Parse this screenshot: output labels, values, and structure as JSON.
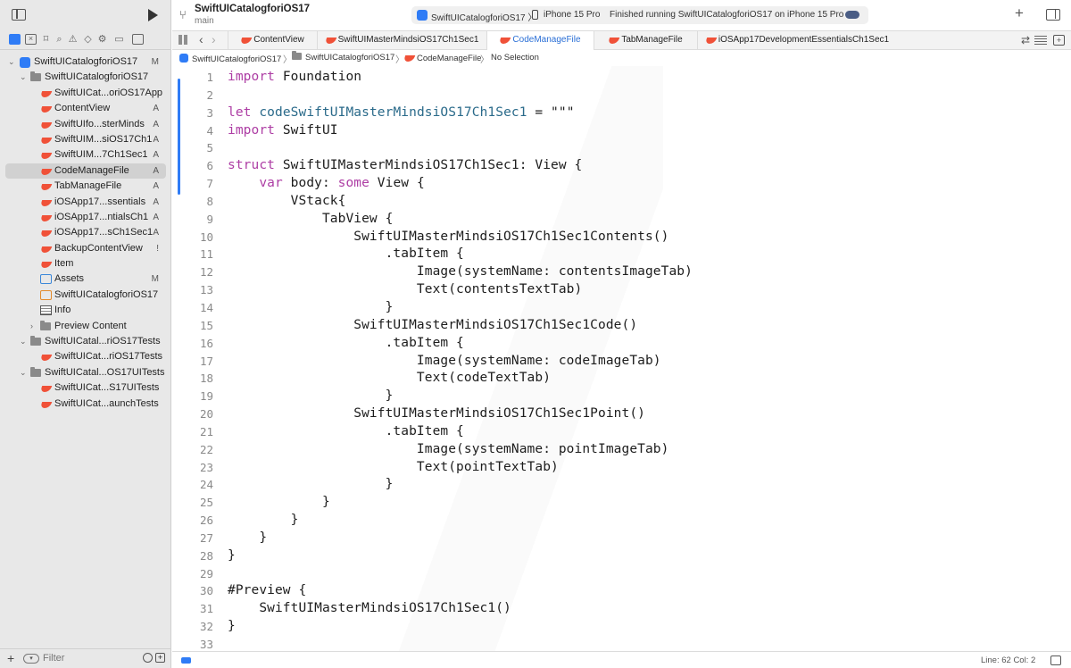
{
  "toolbar": {
    "project_name": "SwiftUICatalogforiOS17",
    "branch": "main",
    "scheme_target": "SwiftUICatalogforiOS17",
    "device": "iPhone 15 Pro",
    "status": "Finished running SwiftUICatalogforiOS17 on iPhone 15 Pro",
    "plus_label": "+",
    "chevron": "〉"
  },
  "tabs": [
    {
      "label": "ContentView",
      "active": false
    },
    {
      "label": "SwiftUIMasterMindsiOS17Ch1Sec1",
      "active": false
    },
    {
      "label": "CodeManageFile",
      "active": true
    },
    {
      "label": "TabManageFile",
      "active": false
    },
    {
      "label": "iOSApp17DevelopmentEssentialsCh1Sec1",
      "active": false
    }
  ],
  "tab_nav": {
    "back": "‹",
    "forward": "›"
  },
  "jumpbar": {
    "items": [
      "SwiftUICatalogforiOS17",
      "SwiftUICatalogforiOS17",
      "CodeManageFile",
      "No Selection"
    ],
    "separator": "〉"
  },
  "navigator": {
    "tree": [
      {
        "label": "SwiftUICatalogforiOS17",
        "badge": "M"
      },
      {
        "label": "SwiftUICatalogforiOS17",
        "badge": ""
      },
      {
        "label": "SwiftUICat...oriOS17App",
        "badge": ""
      },
      {
        "label": "ContentView",
        "badge": "A"
      },
      {
        "label": "SwiftUIfo...sterMinds",
        "badge": "A"
      },
      {
        "label": "SwiftUIM...siOS17Ch1",
        "badge": "A"
      },
      {
        "label": "SwiftUIM...7Ch1Sec1",
        "badge": "A"
      },
      {
        "label": "CodeManageFile",
        "badge": "A"
      },
      {
        "label": "TabManageFile",
        "badge": "A"
      },
      {
        "label": "iOSApp17...ssentials",
        "badge": "A"
      },
      {
        "label": "iOSApp17...ntialsCh1",
        "badge": "A"
      },
      {
        "label": "iOSApp17...sCh1Sec1",
        "badge": "A"
      },
      {
        "label": "BackupContentView",
        "badge": "!"
      },
      {
        "label": "Item",
        "badge": ""
      },
      {
        "label": "Assets",
        "badge": "M"
      },
      {
        "label": "SwiftUICatalogforiOS17",
        "badge": ""
      },
      {
        "label": "Info",
        "badge": ""
      },
      {
        "label": "Preview Content",
        "badge": ""
      },
      {
        "label": "SwiftUICatal...riOS17Tests",
        "badge": ""
      },
      {
        "label": "SwiftUICat...riOS17Tests",
        "badge": ""
      },
      {
        "label": "SwiftUICatal...OS17UITests",
        "badge": ""
      },
      {
        "label": "SwiftUICat...S17UITests",
        "badge": ""
      },
      {
        "label": "SwiftUICat...aunchTests",
        "badge": ""
      }
    ],
    "filter_placeholder": "Filter",
    "add_label": "+"
  },
  "editor": {
    "lines": [
      {
        "n": "1",
        "text": "import Foundation"
      },
      {
        "n": "2",
        "text": ""
      },
      {
        "n": "3",
        "text": "let codeSwiftUIMasterMindsiOS17Ch1Sec1 = \"\"\""
      },
      {
        "n": "4",
        "text": "import SwiftUI"
      },
      {
        "n": "5",
        "text": ""
      },
      {
        "n": "6",
        "text": "struct SwiftUIMasterMindsiOS17Ch1Sec1: View {"
      },
      {
        "n": "7",
        "text": "    var body: some View {"
      },
      {
        "n": "8",
        "text": "        VStack{"
      },
      {
        "n": "9",
        "text": "            TabView {"
      },
      {
        "n": "10",
        "text": "                SwiftUIMasterMindsiOS17Ch1Sec1Contents()"
      },
      {
        "n": "11",
        "text": "                    .tabItem {"
      },
      {
        "n": "12",
        "text": "                        Image(systemName: contentsImageTab)"
      },
      {
        "n": "13",
        "text": "                        Text(contentsTextTab)"
      },
      {
        "n": "14",
        "text": "                    }"
      },
      {
        "n": "15",
        "text": "                SwiftUIMasterMindsiOS17Ch1Sec1Code()"
      },
      {
        "n": "16",
        "text": "                    .tabItem {"
      },
      {
        "n": "17",
        "text": "                        Image(systemName: codeImageTab)"
      },
      {
        "n": "18",
        "text": "                        Text(codeTextTab)"
      },
      {
        "n": "19",
        "text": "                    }"
      },
      {
        "n": "20",
        "text": "                SwiftUIMasterMindsiOS17Ch1Sec1Point()"
      },
      {
        "n": "21",
        "text": "                    .tabItem {"
      },
      {
        "n": "22",
        "text": "                        Image(systemName: pointImageTab)"
      },
      {
        "n": "23",
        "text": "                        Text(pointTextTab)"
      },
      {
        "n": "24",
        "text": "                    }"
      },
      {
        "n": "25",
        "text": "            }"
      },
      {
        "n": "26",
        "text": "        }"
      },
      {
        "n": "27",
        "text": "    }"
      },
      {
        "n": "28",
        "text": "}"
      },
      {
        "n": "29",
        "text": ""
      },
      {
        "n": "30",
        "text": "#Preview {"
      },
      {
        "n": "31",
        "text": "    SwiftUIMasterMindsiOS17Ch1Sec1()"
      },
      {
        "n": "32",
        "text": "}"
      },
      {
        "n": "33",
        "text": ""
      }
    ]
  },
  "statusbar": {
    "line_col": "Line: 62  Col: 2"
  },
  "colors": {
    "accent": "#2f7cf6",
    "keyword": "#ad3da4",
    "identifier": "#2a6a8a",
    "swift": "#f05138"
  }
}
